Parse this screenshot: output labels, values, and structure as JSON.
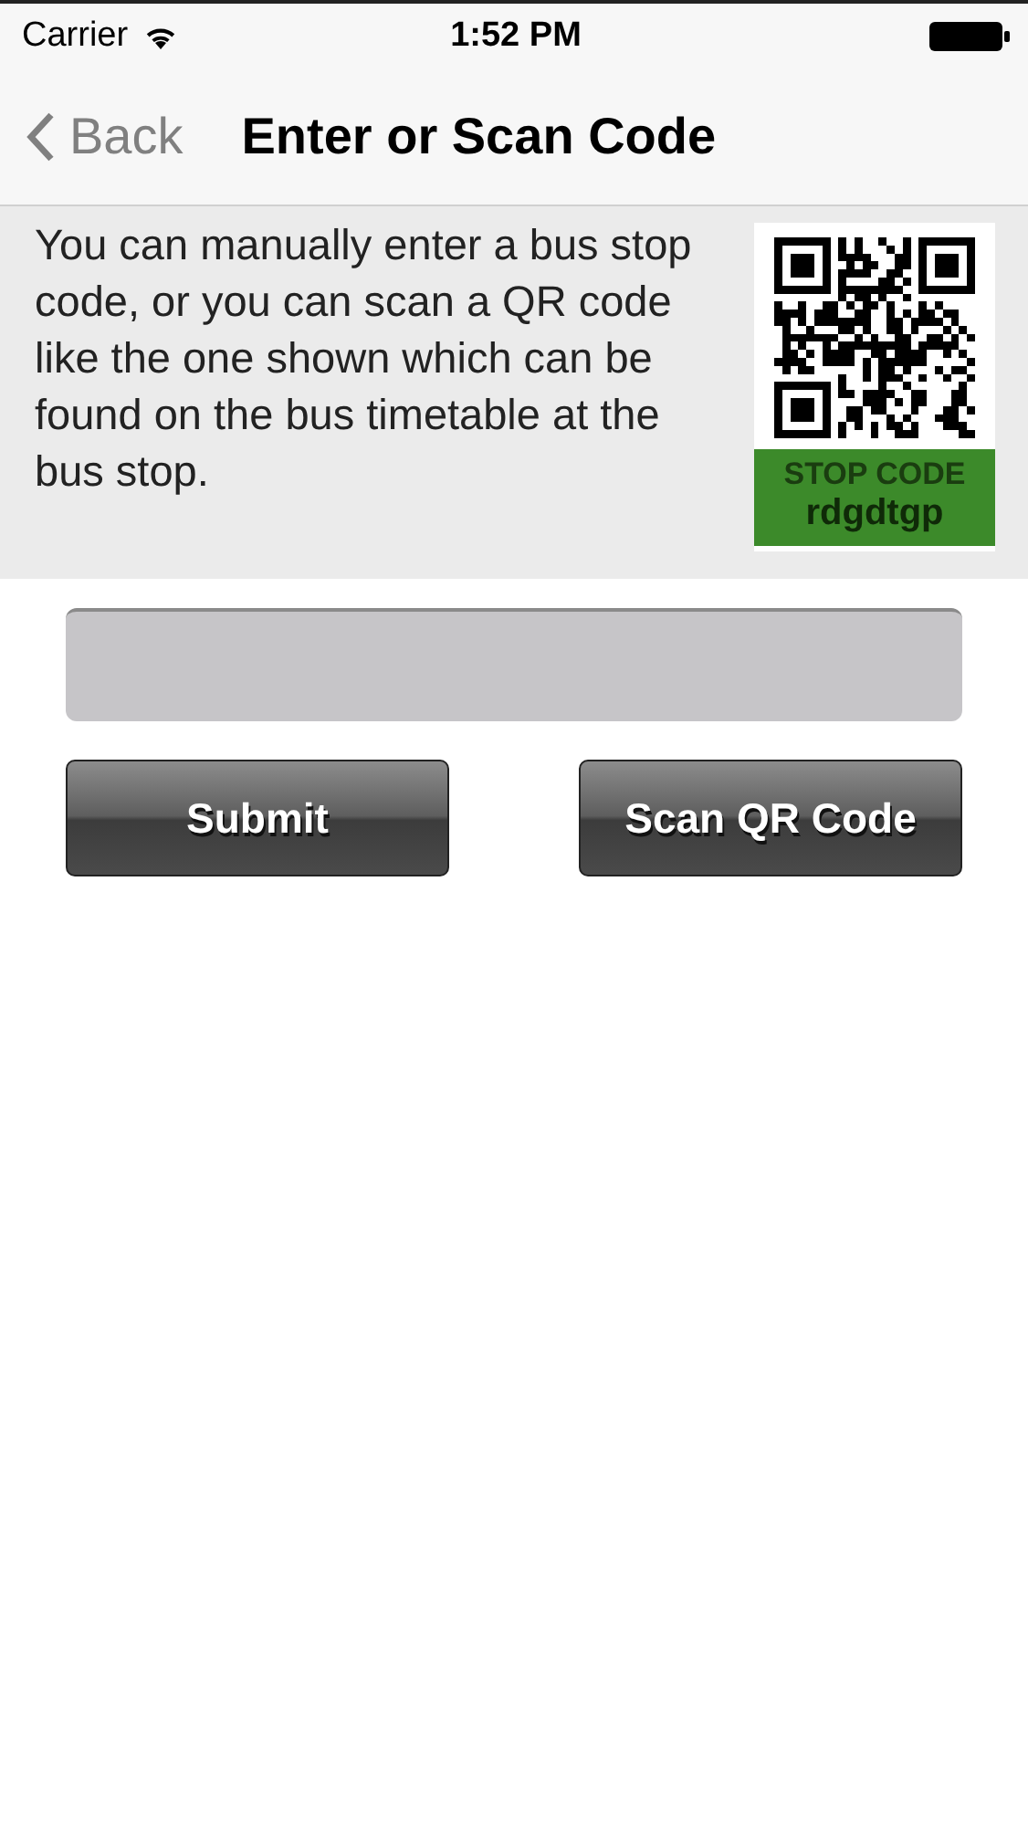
{
  "status_bar": {
    "carrier": "Carrier",
    "time": "1:52 PM"
  },
  "nav_bar": {
    "back": "Back",
    "title": "Enter or Scan Code"
  },
  "info": {
    "text": "You can manually enter a bus stop code, or you can scan a QR code like the one shown which can be found on the bus timetable at the bus stop.",
    "qr_caption": "STOP CODE",
    "qr_code": "rdgdtgp"
  },
  "buttons": [
    {
      "label": "Submit"
    },
    {
      "label": "Scan QR Code"
    }
  ]
}
